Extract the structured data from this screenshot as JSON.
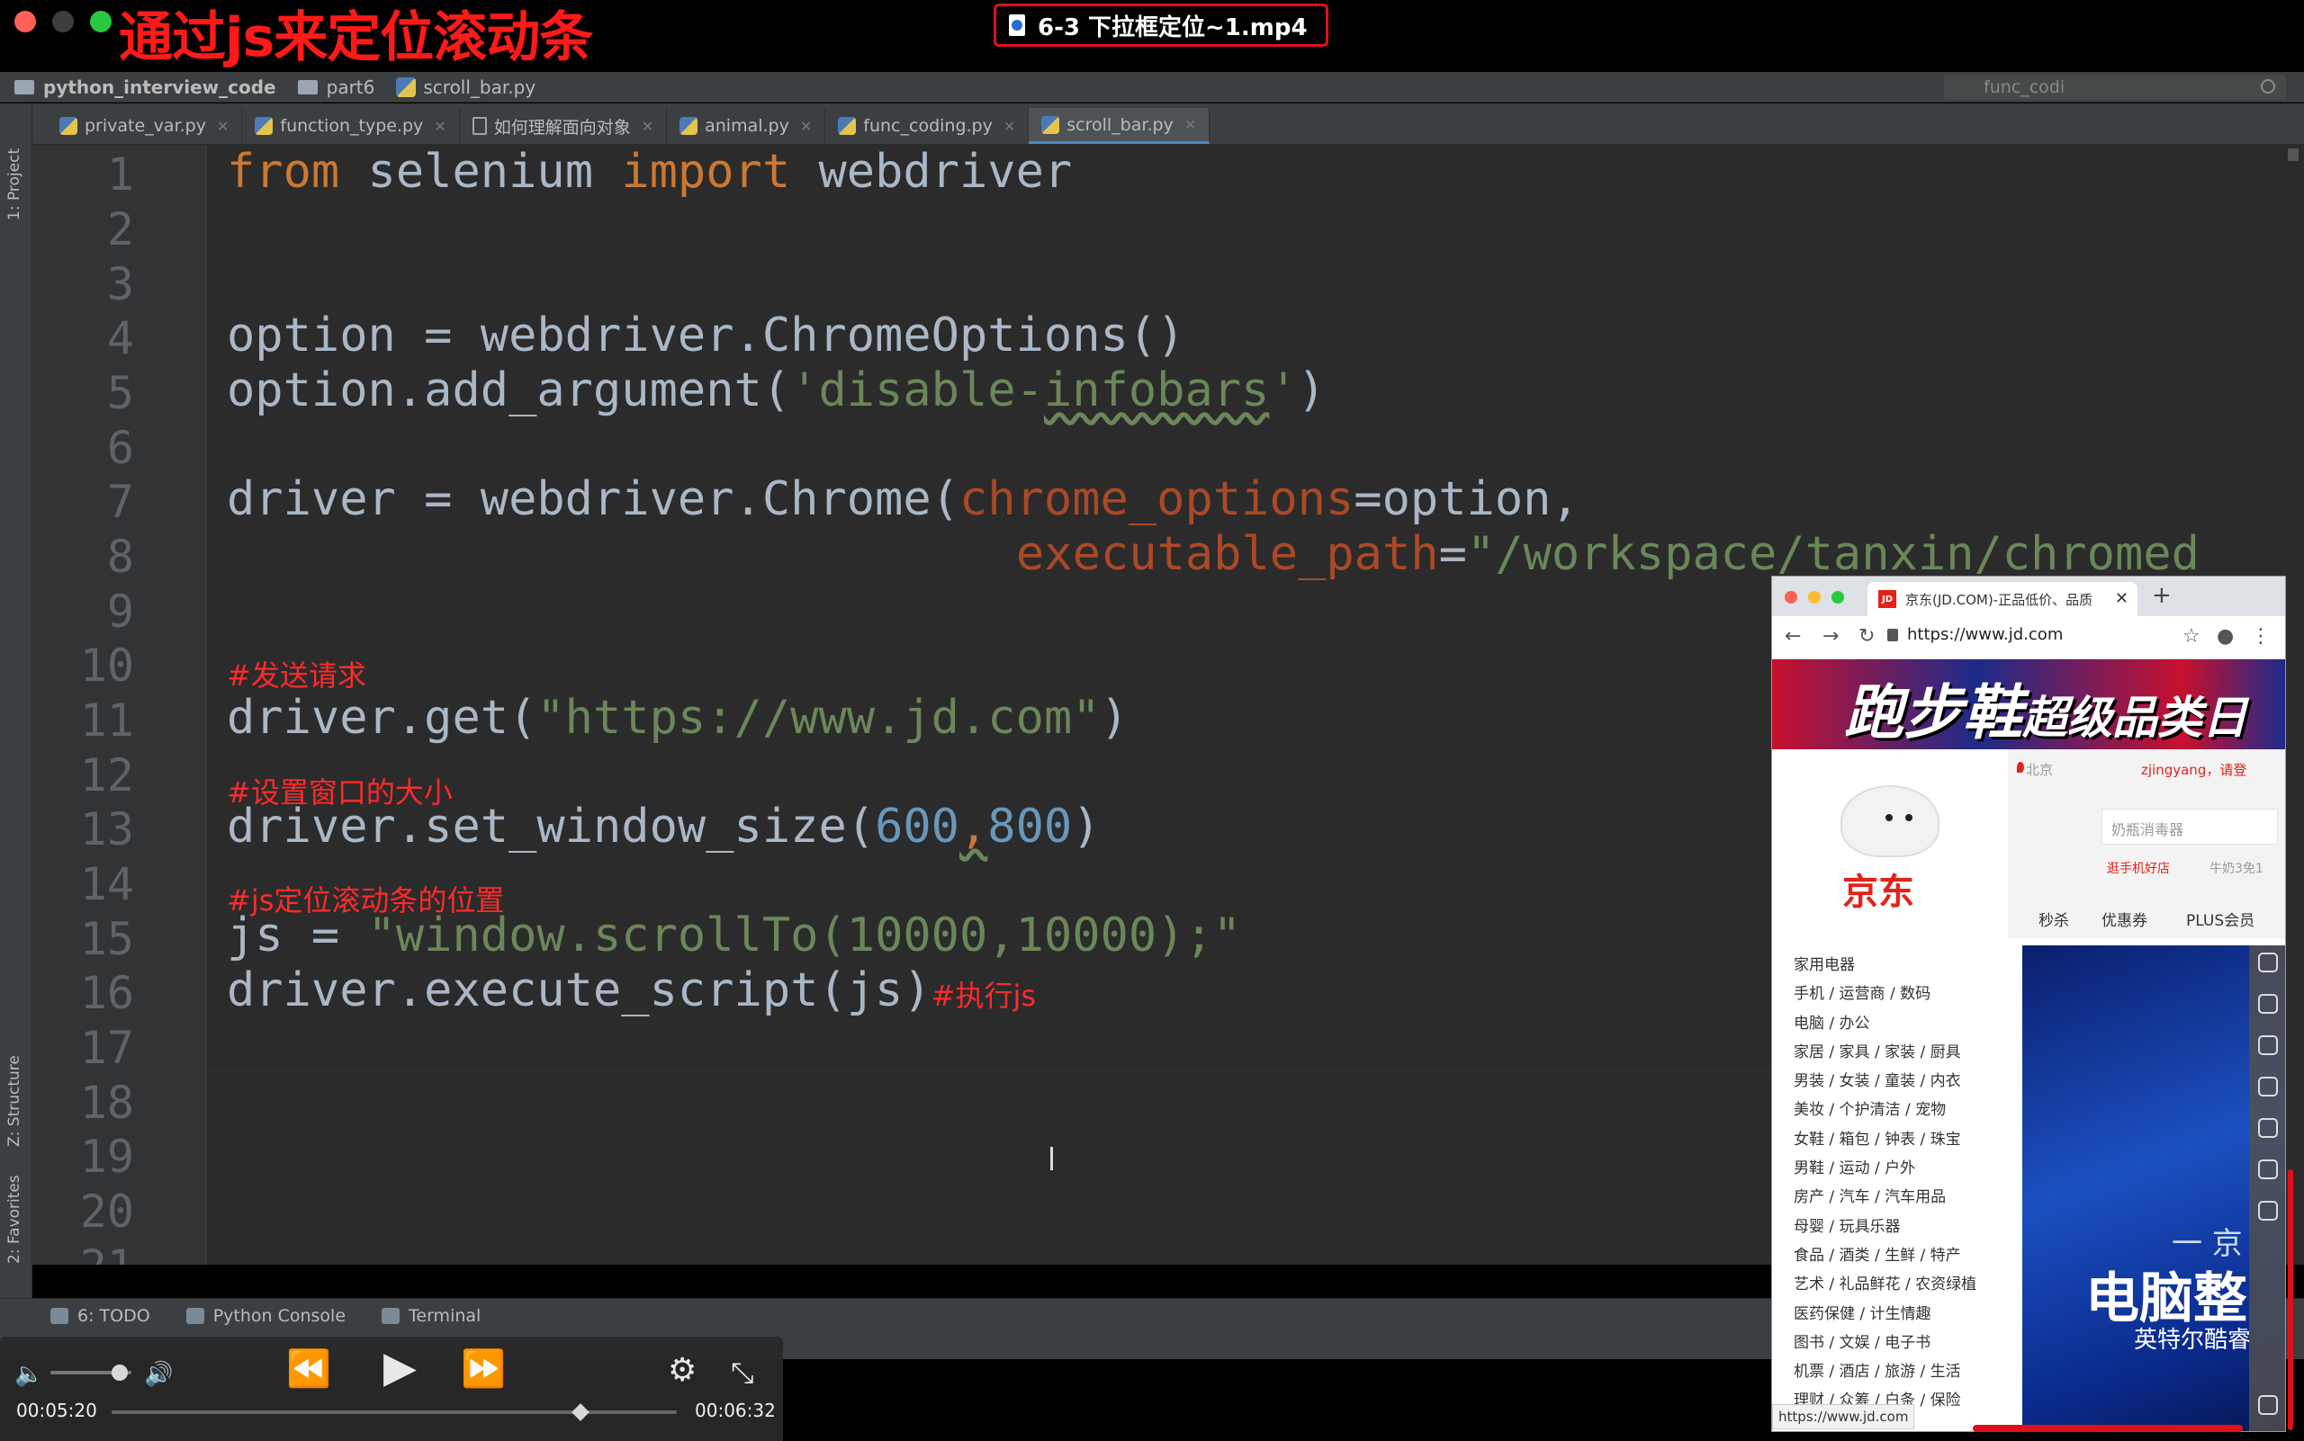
{
  "overlay": {
    "title": "通过js来定位滚动条",
    "video_file": "6-3 下拉框定位~1.mp4"
  },
  "navbar": {
    "project": "python_interview_code",
    "folder": "part6",
    "file": "scroll_bar.py",
    "search_value": "func_codi"
  },
  "tabs": [
    {
      "label": "private_var.py",
      "active": false
    },
    {
      "label": "function_type.py",
      "active": false
    },
    {
      "label": "如何理解面向对象",
      "active": false
    },
    {
      "label": "animal.py",
      "active": false
    },
    {
      "label": "func_coding.py",
      "active": false
    },
    {
      "label": "scroll_bar.py",
      "active": true
    }
  ],
  "left_strip": {
    "project": "1: Project",
    "structure": "Z: Structure",
    "favorites": "2: Favorites"
  },
  "editor": {
    "line_numbers": [
      "1",
      "2",
      "3",
      "4",
      "5",
      "6",
      "7",
      "8",
      "9",
      "10",
      "11",
      "12",
      "13",
      "14",
      "15",
      "16",
      "17",
      "18",
      "19",
      "20",
      "21"
    ],
    "code": {
      "l1_from": "from",
      "l1_mod": " selenium ",
      "l1_import": "import",
      "l1_name": " webdriver",
      "l4": "option = webdriver.ChromeOptions()",
      "l5_a": "option.add_argument(",
      "l5_str_a": "'disable-",
      "l5_str_b": "infobars",
      "l5_str_c": "'",
      "l5_b": ")",
      "l7_a": "driver = webdriver.Chrome(",
      "l7_param": "chrome_options",
      "l7_b": "=option,",
      "l8_param": "executable_path",
      "l8_b": "=",
      "l8_str": "\"/workspace/tanxin/chromed",
      "l10_comment": "#发送请求",
      "l11_a": "driver.get(",
      "l11_str": "\"https://www.jd.com\"",
      "l11_b": ")",
      "l12_comment": "#设置窗口的大小",
      "l13_a": "driver.set_window_size(",
      "l13_n1": "600",
      "l13_comma": ",",
      "l13_n2": "800",
      "l13_b": ")",
      "l14_comment": "#js定位滚动条的位置",
      "l15_a": "js = ",
      "l15_str": "\"window.scrollTo(10000,10000);\"",
      "l16_a": "driver.execute_script(js)",
      "l16_comment": "#执行js"
    }
  },
  "bottom_tools": {
    "todo": "6: TODO",
    "console": "Python Console",
    "terminal": "Terminal"
  },
  "player": {
    "elapsed": "00:05:20",
    "remaining": "00:06:32",
    "progress": 0.83,
    "volume": 0.85
  },
  "browser": {
    "tab_title": "京东(JD.COM)-正品低价、品质",
    "favicon": "JD",
    "url": "https://www.jd.com",
    "status_url": "https://www.jd.com",
    "banner_main": "跑步鞋",
    "banner_sub": "超级品类日",
    "logo_text": "京东",
    "city": "北京",
    "user": "zjingyang，请登",
    "search_placeholder": "奶瓶消毒器",
    "hot1": "逛手机好店",
    "hot2": "牛奶3免1",
    "nav": [
      "秒杀",
      "优惠券",
      "PLUS会员"
    ],
    "categories": [
      "家用电器",
      "手机 / 运营商 / 数码",
      "电脑 / 办公",
      "家居 / 家具 / 家装 / 厨具",
      "男装 / 女装 / 童装 / 内衣",
      "美妆 / 个护清洁 / 宠物",
      "女鞋 / 箱包 / 钟表 / 珠宝",
      "男鞋 / 运动 / 户外",
      "房产 / 汽车 / 汽车用品",
      "母婴 / 玩具乐器",
      "食品 / 酒类 / 生鲜 / 特产",
      "艺术 / 礼品鲜花 / 农资绿植",
      "医药保健 / 计生情趣",
      "图书 / 文娱 / 电子书",
      "机票 / 酒店 / 旅游 / 生活",
      "理财 / 众筹 / 白条 / 保险"
    ],
    "promo_title": "电脑整",
    "promo_sub": "英特尔酷睿",
    "promo_dash": "一 京"
  },
  "colors": {
    "overlay_red": "#ff1a1a",
    "editor_bg": "#2b2b2b",
    "keyword": "#cc7832",
    "string": "#6a8759",
    "number": "#6897bb",
    "param": "#aa4926",
    "jd_red": "#e2231a"
  }
}
